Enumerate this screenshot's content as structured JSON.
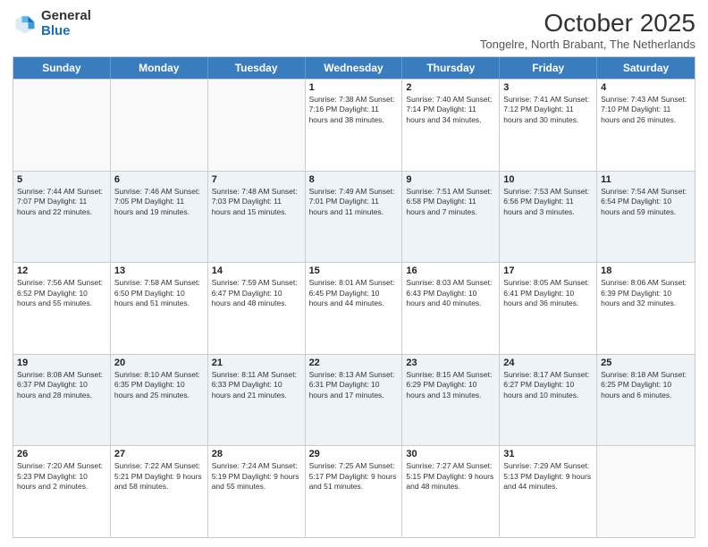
{
  "logo": {
    "general": "General",
    "blue": "Blue"
  },
  "title": "October 2025",
  "subtitle": "Tongelre, North Brabant, The Netherlands",
  "days": [
    "Sunday",
    "Monday",
    "Tuesday",
    "Wednesday",
    "Thursday",
    "Friday",
    "Saturday"
  ],
  "weeks": [
    [
      {
        "day": "",
        "info": ""
      },
      {
        "day": "",
        "info": ""
      },
      {
        "day": "",
        "info": ""
      },
      {
        "day": "1",
        "info": "Sunrise: 7:38 AM\nSunset: 7:16 PM\nDaylight: 11 hours\nand 38 minutes."
      },
      {
        "day": "2",
        "info": "Sunrise: 7:40 AM\nSunset: 7:14 PM\nDaylight: 11 hours\nand 34 minutes."
      },
      {
        "day": "3",
        "info": "Sunrise: 7:41 AM\nSunset: 7:12 PM\nDaylight: 11 hours\nand 30 minutes."
      },
      {
        "day": "4",
        "info": "Sunrise: 7:43 AM\nSunset: 7:10 PM\nDaylight: 11 hours\nand 26 minutes."
      }
    ],
    [
      {
        "day": "5",
        "info": "Sunrise: 7:44 AM\nSunset: 7:07 PM\nDaylight: 11 hours\nand 22 minutes."
      },
      {
        "day": "6",
        "info": "Sunrise: 7:46 AM\nSunset: 7:05 PM\nDaylight: 11 hours\nand 19 minutes."
      },
      {
        "day": "7",
        "info": "Sunrise: 7:48 AM\nSunset: 7:03 PM\nDaylight: 11 hours\nand 15 minutes."
      },
      {
        "day": "8",
        "info": "Sunrise: 7:49 AM\nSunset: 7:01 PM\nDaylight: 11 hours\nand 11 minutes."
      },
      {
        "day": "9",
        "info": "Sunrise: 7:51 AM\nSunset: 6:58 PM\nDaylight: 11 hours\nand 7 minutes."
      },
      {
        "day": "10",
        "info": "Sunrise: 7:53 AM\nSunset: 6:56 PM\nDaylight: 11 hours\nand 3 minutes."
      },
      {
        "day": "11",
        "info": "Sunrise: 7:54 AM\nSunset: 6:54 PM\nDaylight: 10 hours\nand 59 minutes."
      }
    ],
    [
      {
        "day": "12",
        "info": "Sunrise: 7:56 AM\nSunset: 6:52 PM\nDaylight: 10 hours\nand 55 minutes."
      },
      {
        "day": "13",
        "info": "Sunrise: 7:58 AM\nSunset: 6:50 PM\nDaylight: 10 hours\nand 51 minutes."
      },
      {
        "day": "14",
        "info": "Sunrise: 7:59 AM\nSunset: 6:47 PM\nDaylight: 10 hours\nand 48 minutes."
      },
      {
        "day": "15",
        "info": "Sunrise: 8:01 AM\nSunset: 6:45 PM\nDaylight: 10 hours\nand 44 minutes."
      },
      {
        "day": "16",
        "info": "Sunrise: 8:03 AM\nSunset: 6:43 PM\nDaylight: 10 hours\nand 40 minutes."
      },
      {
        "day": "17",
        "info": "Sunrise: 8:05 AM\nSunset: 6:41 PM\nDaylight: 10 hours\nand 36 minutes."
      },
      {
        "day": "18",
        "info": "Sunrise: 8:06 AM\nSunset: 6:39 PM\nDaylight: 10 hours\nand 32 minutes."
      }
    ],
    [
      {
        "day": "19",
        "info": "Sunrise: 8:08 AM\nSunset: 6:37 PM\nDaylight: 10 hours\nand 28 minutes."
      },
      {
        "day": "20",
        "info": "Sunrise: 8:10 AM\nSunset: 6:35 PM\nDaylight: 10 hours\nand 25 minutes."
      },
      {
        "day": "21",
        "info": "Sunrise: 8:11 AM\nSunset: 6:33 PM\nDaylight: 10 hours\nand 21 minutes."
      },
      {
        "day": "22",
        "info": "Sunrise: 8:13 AM\nSunset: 6:31 PM\nDaylight: 10 hours\nand 17 minutes."
      },
      {
        "day": "23",
        "info": "Sunrise: 8:15 AM\nSunset: 6:29 PM\nDaylight: 10 hours\nand 13 minutes."
      },
      {
        "day": "24",
        "info": "Sunrise: 8:17 AM\nSunset: 6:27 PM\nDaylight: 10 hours\nand 10 minutes."
      },
      {
        "day": "25",
        "info": "Sunrise: 8:18 AM\nSunset: 6:25 PM\nDaylight: 10 hours\nand 6 minutes."
      }
    ],
    [
      {
        "day": "26",
        "info": "Sunrise: 7:20 AM\nSunset: 5:23 PM\nDaylight: 10 hours\nand 2 minutes."
      },
      {
        "day": "27",
        "info": "Sunrise: 7:22 AM\nSunset: 5:21 PM\nDaylight: 9 hours\nand 58 minutes."
      },
      {
        "day": "28",
        "info": "Sunrise: 7:24 AM\nSunset: 5:19 PM\nDaylight: 9 hours\nand 55 minutes."
      },
      {
        "day": "29",
        "info": "Sunrise: 7:25 AM\nSunset: 5:17 PM\nDaylight: 9 hours\nand 51 minutes."
      },
      {
        "day": "30",
        "info": "Sunrise: 7:27 AM\nSunset: 5:15 PM\nDaylight: 9 hours\nand 48 minutes."
      },
      {
        "day": "31",
        "info": "Sunrise: 7:29 AM\nSunset: 5:13 PM\nDaylight: 9 hours\nand 44 minutes."
      },
      {
        "day": "",
        "info": ""
      }
    ]
  ]
}
